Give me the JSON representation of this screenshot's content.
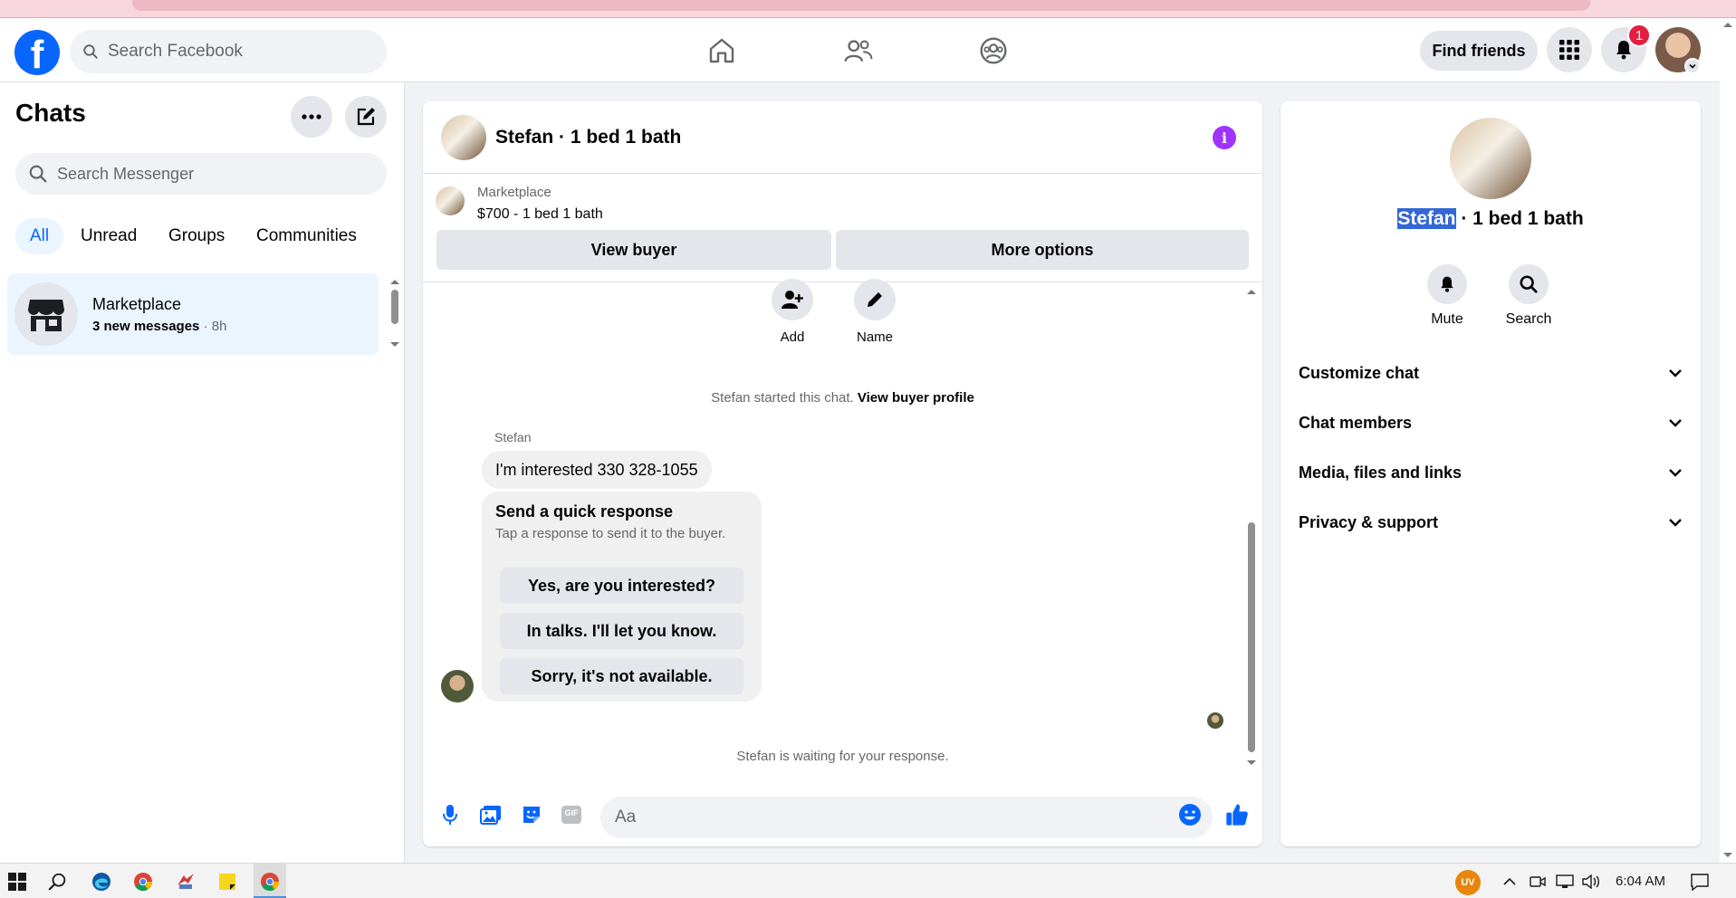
{
  "topbar": {
    "logo": "f",
    "search_placeholder": "Search Facebook",
    "find_friends": "Find friends",
    "notification_count": "1",
    "icons": [
      "home-icon",
      "friends-icon",
      "groups-icon",
      "menu-grid-icon",
      "bell-icon"
    ]
  },
  "sidebar": {
    "title": "Chats",
    "search_placeholder": "Search Messenger",
    "filters": [
      "All",
      "Unread",
      "Groups",
      "Communities"
    ],
    "active_filter": "All",
    "chats": [
      {
        "name": "Marketplace",
        "preview": "3 new messages",
        "time": "8h"
      }
    ]
  },
  "conversation": {
    "title": "Stefan · 1 bed 1 bath",
    "listing": {
      "category": "Marketplace",
      "price_line": "$700 - 1 bed 1 bath",
      "view_buyer": "View buyer",
      "more_options": "More options"
    },
    "actions": [
      "Add",
      "Name"
    ],
    "system_started": "Stefan started this chat.",
    "view_buyer_profile": "View buyer profile",
    "sender": "Stefan",
    "message": "I'm interested 330 328-1055",
    "quick_response": {
      "title": "Send a quick response",
      "subtitle": "Tap a response to send it to the buyer.",
      "options": [
        "Yes, are you interested?",
        "In talks. I'll let you know.",
        "Sorry, it's not available."
      ]
    },
    "waiting": "Stefan is waiting for your response.",
    "composer_placeholder": "Aa",
    "composer_icons": [
      "microphone-icon",
      "photo-icon",
      "sticker-icon",
      "gif-icon",
      "emoji-icon",
      "thumbs-up-icon"
    ],
    "gif_label": "GIF"
  },
  "info_panel": {
    "name_highlight": "Stefan",
    "title_rest": " · 1 bed 1 bath",
    "actions": [
      "Mute",
      "Search"
    ],
    "sections": [
      "Customize chat",
      "Chat members",
      "Media, files and links",
      "Privacy & support"
    ]
  },
  "taskbar": {
    "time": "6:04 AM",
    "uv_label": "UV"
  },
  "colors": {
    "brand": "#0866ff",
    "info": "#a033ff",
    "badge": "#e41e3f",
    "highlight": "#3367d6"
  }
}
